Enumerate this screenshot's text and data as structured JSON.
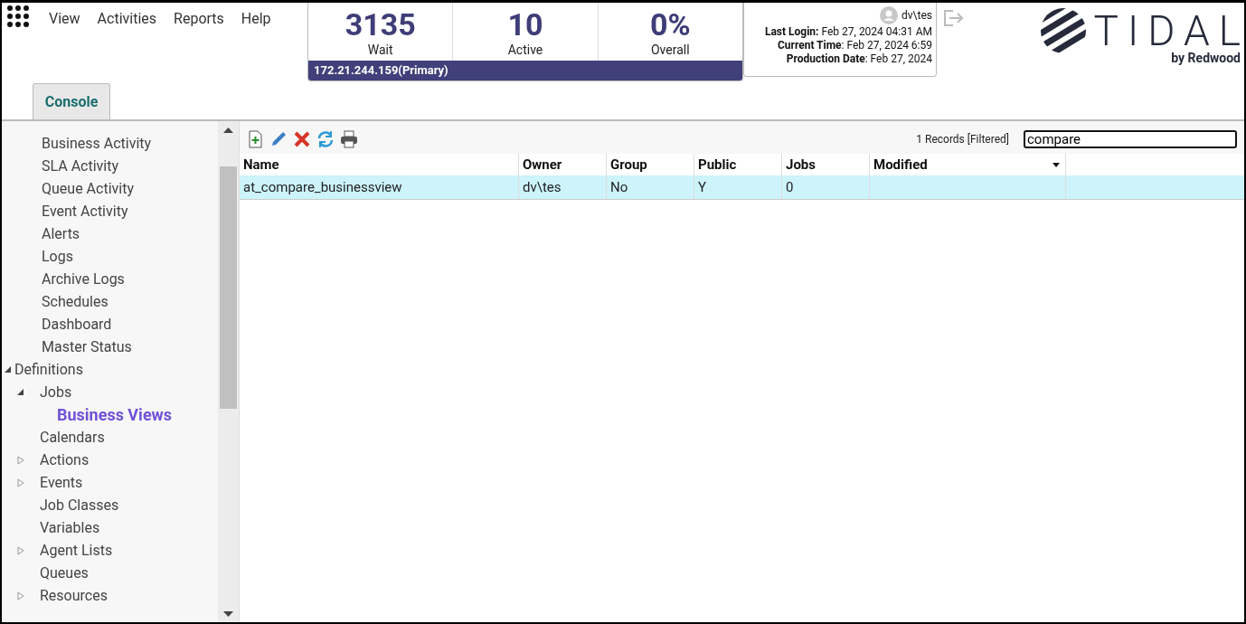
{
  "menu": [
    "View",
    "Activities",
    "Reports",
    "Help"
  ],
  "stats": [
    {
      "value": "3135",
      "label": "Wait"
    },
    {
      "value": "10",
      "label": "Active"
    },
    {
      "value": "0%",
      "label": "Overall"
    }
  ],
  "server": "172.21.244.159(Primary)",
  "user": {
    "name": "dv\\tes",
    "info": [
      {
        "label": "Last Login:",
        "value": " Feb 27, 2024 04:31 AM"
      },
      {
        "label": "Current Time",
        "value": ": Feb 27, 2024 6:59"
      },
      {
        "label": "Production Date",
        "value": ": Feb 27, 2024"
      }
    ]
  },
  "logo": {
    "name": "TIDAL",
    "tagline": "by Redwood"
  },
  "tabs": [
    {
      "label": "Console",
      "selected": true
    }
  ],
  "sidebar": {
    "partial_group": [
      {
        "label": "Business Activity",
        "selected": false
      },
      {
        "label": "SLA Activity",
        "selected": false
      },
      {
        "label": "Queue Activity",
        "selected": false
      },
      {
        "label": "Event Activity",
        "selected": false
      },
      {
        "label": "Alerts",
        "selected": false
      },
      {
        "label": "Logs",
        "selected": false
      },
      {
        "label": "Archive Logs",
        "selected": false
      },
      {
        "label": "Schedules",
        "selected": false
      },
      {
        "label": "Dashboard",
        "selected": false
      },
      {
        "label": "Master Status",
        "selected": false
      }
    ],
    "tree": [
      {
        "label": "Definitions",
        "selected": false,
        "expanded": true,
        "children": [
          {
            "label": "Jobs",
            "selected": false,
            "expanded": true,
            "children": [
              {
                "label": "Business Views",
                "selected": true
              }
            ]
          },
          {
            "label": "Calendars",
            "selected": false
          },
          {
            "label": "Actions",
            "selected": false,
            "expanded": false
          },
          {
            "label": "Events",
            "selected": false,
            "expanded": false
          },
          {
            "label": "Job Classes",
            "selected": false
          },
          {
            "label": "Variables",
            "selected": false
          },
          {
            "label": "Agent Lists",
            "selected": false,
            "expanded": false
          },
          {
            "label": "Queues",
            "selected": false
          },
          {
            "label": "Resources",
            "selected": false,
            "expanded": false
          }
        ]
      }
    ]
  },
  "records": "1 Records [Filtered]",
  "search": {
    "value": "compare"
  },
  "table": {
    "columns": [
      "Name",
      "Owner",
      "Group",
      "Public",
      "Jobs",
      "Modified"
    ],
    "rows": [
      {
        "cells": [
          "at_compare_businessview",
          "dv\\tes",
          "No",
          "Y",
          "0",
          ""
        ],
        "selected": true
      }
    ]
  }
}
